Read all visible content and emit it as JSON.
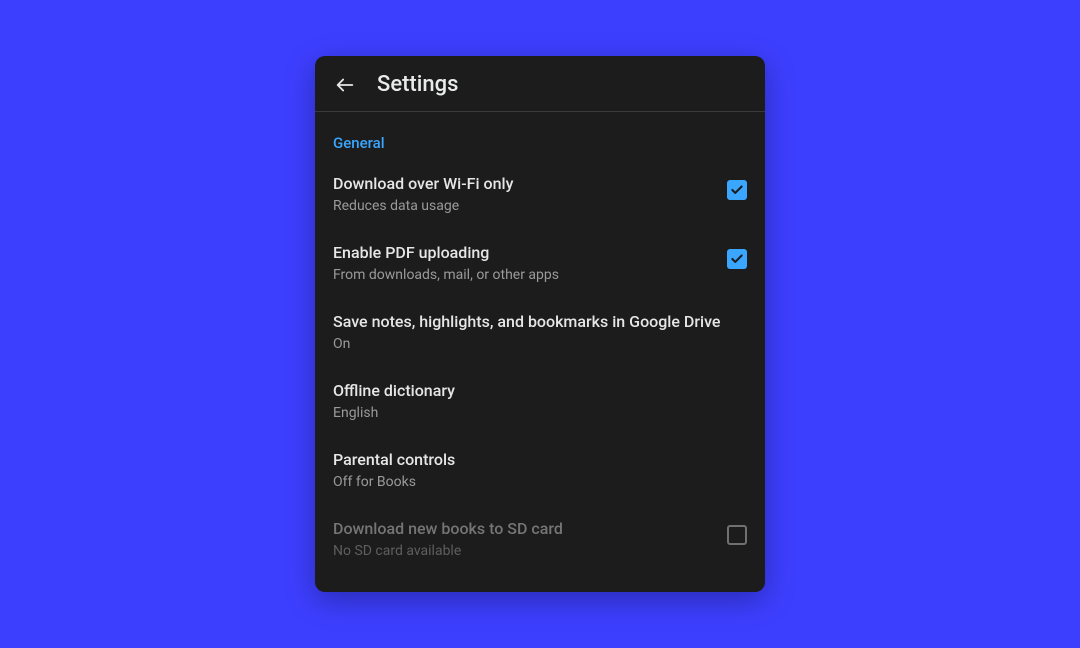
{
  "header": {
    "title": "Settings"
  },
  "section_label": "General",
  "rows": {
    "wifi": {
      "title": "Download over Wi-Fi only",
      "sub": "Reduces data usage"
    },
    "pdf": {
      "title": "Enable PDF uploading",
      "sub": "From downloads, mail, or other apps"
    },
    "notes": {
      "title": "Save notes, highlights, and bookmarks in Google Drive",
      "sub": "On"
    },
    "dict": {
      "title": "Offline dictionary",
      "sub": "English"
    },
    "parental": {
      "title": "Parental controls",
      "sub": "Off for Books"
    },
    "sd": {
      "title": "Download new books to SD card",
      "sub": "No SD card available"
    }
  }
}
